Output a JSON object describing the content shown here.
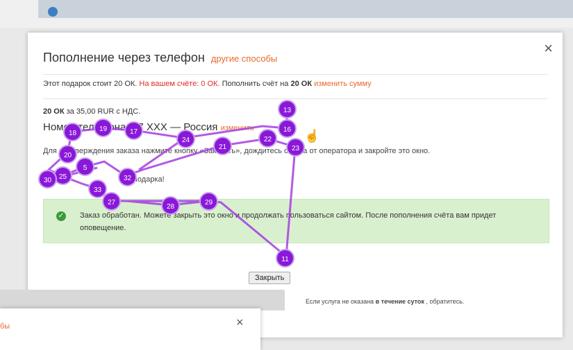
{
  "dialog": {
    "title": "Пополнение через телефон",
    "alt_link": "другие способы",
    "close_glyph": "×",
    "gift_prefix": "Этот подарок стоит 20 ОК.",
    "balance": "На вашем счёте: 0 ОК.",
    "topup_prefix": "Пополнить счёт на",
    "topup_amount": "20 ОК",
    "change_link": "изменить сумму",
    "price_bold": "20 ОК",
    "price_text": "за 35,00 RUR с НДС.",
    "phone_label": "Номер телефона: +7 XXX — Россия",
    "phone_change": "изменить",
    "instructions": "Для подтверждения заказа нажмите кнопку «Заказать», дождитесь ответа от оператора и закройте это окно.",
    "gift_note": "Подарка!",
    "success_text": "Заказ обработан. Можете закрыть это окно и продолжать пользоваться сайтом. После пополнения счёта вам придет оповещение.",
    "close_button": "Закрыть",
    "footer_prefix": "Если услуга не оказана",
    "footer_bold": "в течение суток",
    "footer_suffix": ", обратитесь."
  },
  "second_dialog": {
    "alt_fragment": "бы",
    "close_glyph": "×"
  },
  "click_nodes": [
    "13",
    "16",
    "18",
    "19",
    "17",
    "22",
    "24",
    "21",
    "23",
    "20",
    "5",
    "25",
    "30",
    "32",
    "33",
    "27",
    "28",
    "29",
    "11"
  ],
  "colors": {
    "node_fill": "#8a18d8",
    "accent_orange": "#e86a2c",
    "alert_red": "#e02a2a",
    "success_bg": "#d9f0cf"
  }
}
